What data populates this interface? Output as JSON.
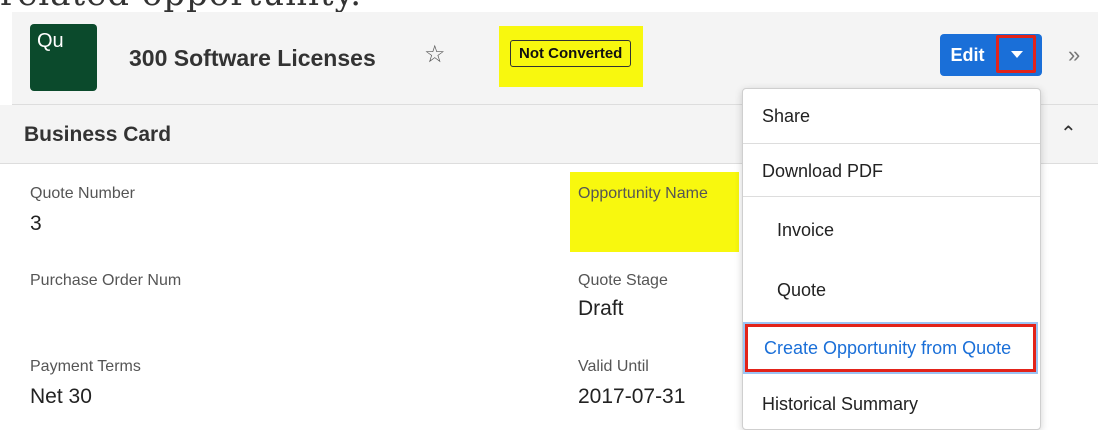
{
  "caption_fragment": "related opportunity.",
  "header": {
    "avatar_text": "Qu",
    "title": "300 Software Licenses",
    "status_badge": "Not Converted",
    "edit_label": "Edit"
  },
  "section": {
    "title": "Business Card"
  },
  "fields": {
    "quote_number_label": "Quote Number",
    "quote_number_value": "3",
    "opportunity_name_label": "Opportunity Name",
    "purchase_order_label": "Purchase Order Num",
    "quote_stage_label": "Quote Stage",
    "quote_stage_value": "Draft",
    "payment_terms_label": "Payment Terms",
    "payment_terms_value": "Net 30",
    "valid_until_label": "Valid Until",
    "valid_until_value": "2017-07-31"
  },
  "dropdown_menu": {
    "items": [
      "Share",
      "Download PDF",
      "Invoice",
      "Quote",
      "Create Opportunity from Quote",
      "Historical Summary"
    ]
  },
  "icons": [
    "star-icon",
    "caret-down-icon",
    "double-chevron-right-icon",
    "chevron-up-icon"
  ],
  "colors": {
    "primary": "#1a6fd8",
    "highlight": "#f8f80e",
    "annotation_red": "#e2231a",
    "avatar_bg": "#0b4a2c"
  }
}
